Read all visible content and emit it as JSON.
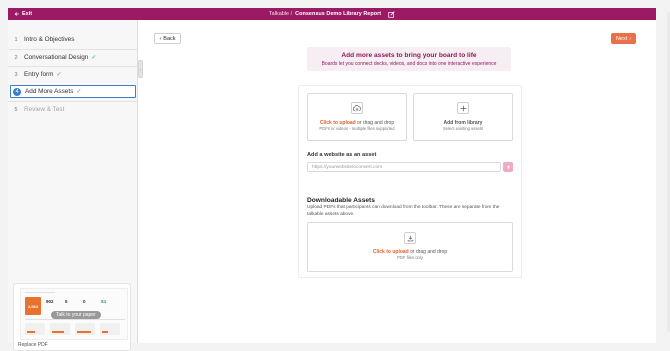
{
  "topbar": {
    "exit_label": "Exit",
    "breadcrumb": "Talkable /",
    "document_title": "Consensus Demo Library Report"
  },
  "sidebar": {
    "steps": [
      {
        "num": "1",
        "label": "Intro & Objectives",
        "status": "default",
        "checked": false
      },
      {
        "num": "2",
        "label": "Conversational Design",
        "status": "default",
        "checked": true
      },
      {
        "num": "3",
        "label": "Entry form",
        "status": "default",
        "checked": true
      },
      {
        "num": "4",
        "label": "Add More Assets",
        "status": "active",
        "checked": true
      },
      {
        "num": "5",
        "label": "Review & Test",
        "status": "disabled",
        "checked": false
      }
    ],
    "check_glyph": "✓",
    "pdf_preview": {
      "talk_label": "Talk to your paper",
      "replace_label": "Replace PDF",
      "thumb_values": [
        "2,064",
        "902",
        "5",
        "0",
        "84"
      ]
    }
  },
  "main": {
    "back_label": "Back",
    "next_label": "Next",
    "banner": {
      "heading": "Add more assets to bring your board to life",
      "subheading": "Boards let you connect decks, videos, and docs into one interactive experience"
    },
    "upload": {
      "link": "Click to upload",
      "rest": " or drag and drop",
      "hint": "PDFs or videos - multiple files supported"
    },
    "library": {
      "link": "Add from library",
      "hint": "Select existing assets"
    },
    "website": {
      "label": "Add a website as an asset",
      "placeholder": "https://yourwebsitetoconvert.com"
    },
    "downloadable": {
      "title": "Downloadable Assets",
      "description": "Upload PDFs that participants can download from the toolbar. These are separate from the talkable assets above.",
      "link": "Click to upload",
      "rest": " or drag and drop",
      "hint": "PDF files only"
    }
  },
  "colors": {
    "brand": "#9b1a63",
    "accent": "#e8714a",
    "active": "#3d7cc9",
    "success": "#3aa86b"
  }
}
